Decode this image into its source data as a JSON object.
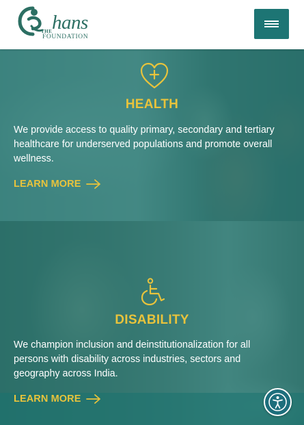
{
  "header": {
    "logo": {
      "the": "THE",
      "wordmark": "hans",
      "foundation": "FOUNDATION"
    },
    "menu_icon": "hamburger-menu-icon"
  },
  "sections": [
    {
      "icon": "heart-plus-icon",
      "title": "HEALTH",
      "text": "We provide access to quality primary, secondary and tertiary healthcare for underserved populations and promote overall wellness.",
      "link": "LEARN MORE"
    },
    {
      "icon": "wheelchair-icon",
      "title": "DISABILITY",
      "text": "We champion inclusion and deinstitutionalization for all persons with disability across industries, sectors and geography across India.",
      "link": "LEARN MORE"
    }
  ],
  "accessibility": {
    "icon": "accessibility-person-icon"
  },
  "colors": {
    "teal": "#1d7574",
    "accent_yellow": "#e8c33c",
    "text_white": "#ffffff"
  }
}
